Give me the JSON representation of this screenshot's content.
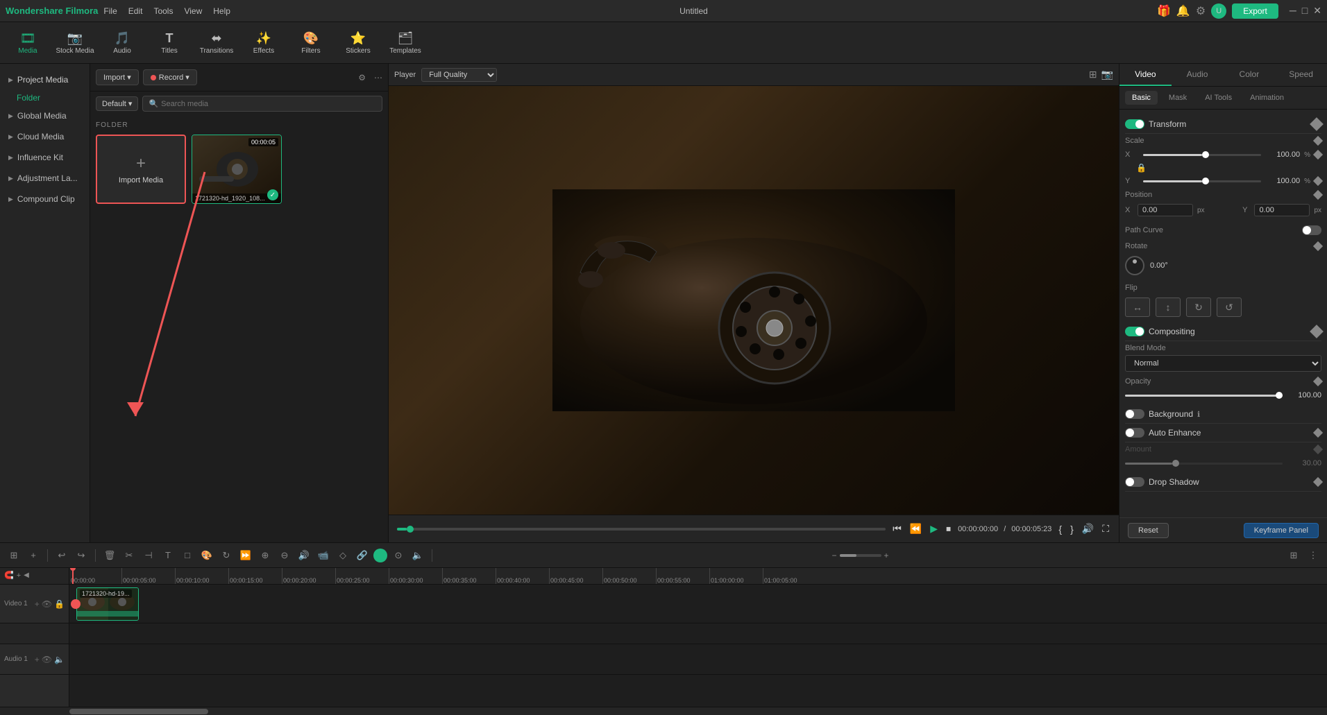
{
  "app": {
    "name": "Wondershare Filmora",
    "title": "Untitled",
    "export_label": "Export"
  },
  "menubar": {
    "items": [
      "File",
      "Edit",
      "Tools",
      "View",
      "Help"
    ]
  },
  "toolbar": {
    "items": [
      {
        "id": "media",
        "icon": "🎞",
        "label": "Media",
        "active": true
      },
      {
        "id": "stock",
        "icon": "📷",
        "label": "Stock Media",
        "active": false
      },
      {
        "id": "audio",
        "icon": "🎵",
        "label": "Audio",
        "active": false
      },
      {
        "id": "titles",
        "icon": "T",
        "label": "Titles",
        "active": false
      },
      {
        "id": "transitions",
        "icon": "⬌",
        "label": "Transitions",
        "active": false
      },
      {
        "id": "effects",
        "icon": "✨",
        "label": "Effects",
        "active": false
      },
      {
        "id": "filters",
        "icon": "🎨",
        "label": "Filters",
        "active": false
      },
      {
        "id": "stickers",
        "icon": "⭐",
        "label": "Stickers",
        "active": false
      },
      {
        "id": "templates",
        "icon": "🗂",
        "label": "Templates",
        "active": false
      }
    ]
  },
  "sidebar": {
    "items": [
      {
        "label": "Project Media",
        "arrow": "▶"
      },
      {
        "label": "Folder",
        "type": "folder"
      },
      {
        "label": "Global Media",
        "arrow": "▶"
      },
      {
        "label": "Cloud Media",
        "arrow": "▶"
      },
      {
        "label": "Influence Kit",
        "arrow": "▶"
      },
      {
        "label": "Adjustment La...",
        "arrow": "▶"
      },
      {
        "label": "Compound Clip",
        "arrow": "▶"
      }
    ]
  },
  "media_panel": {
    "import_label": "Import",
    "record_label": "Record",
    "default_label": "Default",
    "search_placeholder": "Search media",
    "folder_label": "FOLDER",
    "media_items": [
      {
        "type": "empty",
        "label": "Import Media"
      },
      {
        "type": "thumb",
        "duration": "00:00:05",
        "filename": "1721320-hd_1920_108...",
        "checked": true
      }
    ]
  },
  "preview": {
    "player_label": "Player",
    "quality": "Full Quality",
    "current_time": "00:00:00:00",
    "total_time": "00:00:05:23",
    "progress_pct": 2
  },
  "right_panel": {
    "tabs": [
      "Video",
      "Audio",
      "Color",
      "Speed"
    ],
    "active_tab": "Video",
    "sub_tabs": [
      "Basic",
      "Mask",
      "AI Tools",
      "Animation"
    ],
    "active_sub": "Basic",
    "transform": {
      "label": "Transform",
      "enabled": true,
      "scale": {
        "label": "Scale",
        "x_val": "100.00",
        "y_val": "100.00",
        "unit": "%"
      },
      "position": {
        "label": "Position",
        "x_val": "0.00",
        "y_val": "0.00",
        "unit": "px"
      },
      "path_curve": {
        "label": "Path Curve",
        "enabled": false
      },
      "rotate": {
        "label": "Rotate",
        "value": "0.00°"
      },
      "flip": {
        "label": "Flip"
      }
    },
    "compositing": {
      "label": "Compositing",
      "enabled": true,
      "blend_mode": {
        "label": "Blend Mode",
        "value": "Normal"
      },
      "opacity": {
        "label": "Opacity",
        "value": "100.00"
      }
    },
    "background": {
      "label": "Background",
      "enabled": false
    },
    "auto_enhance": {
      "label": "Auto Enhance",
      "enabled": false,
      "amount": {
        "label": "Amount",
        "value": "30.00"
      }
    },
    "drop_shadow": {
      "label": "Drop Shadow",
      "enabled": false
    },
    "footer": {
      "reset_label": "Reset",
      "keyframe_label": "Keyframe Panel"
    }
  },
  "timeline": {
    "tracks": [
      {
        "label": "Video 1",
        "type": "video"
      },
      {
        "label": "Audio 1",
        "type": "audio"
      }
    ],
    "ruler_marks": [
      "00:00:00",
      "00:00:05:00",
      "00:00:10:00",
      "00:00:15:00",
      "00:00:20:00",
      "00:00:25:00",
      "00:00:30:00",
      "00:00:35:00",
      "00:00:40:00",
      "00:00:45:00",
      "00:00:50:00",
      "00:00:55:00",
      "01:00:00:00",
      "01:00:05:00"
    ],
    "clip": {
      "label": "1721320-hd-19...",
      "left": 0,
      "width": 90
    }
  }
}
